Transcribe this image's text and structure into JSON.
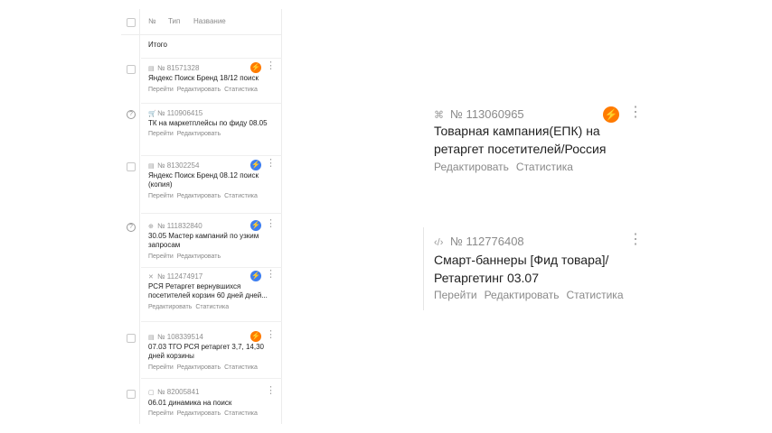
{
  "table": {
    "header": {
      "num": "№",
      "type": "Тип",
      "name": "Название"
    },
    "total_label": "Итого",
    "rows": [
      {
        "num": "№ 81571328",
        "icon": "search-icon",
        "title": "Яндекс Поиск Бренд 18/12 поиск",
        "links": [
          "Перейти",
          "Редактировать",
          "Статистика"
        ],
        "bolt": "orange"
      },
      {
        "num": "№ 110906415",
        "icon": "cart-icon",
        "title": "ТК на маркетплейсы по фиду 08.05",
        "links": [
          "Перейти",
          "Редактировать"
        ],
        "bolt": ""
      },
      {
        "num": "№ 81302254",
        "icon": "search-icon",
        "title": "Яндекс Поиск Бренд 08.12 поиск (копия)",
        "links": [
          "Перейти",
          "Редактировать",
          "Статистика"
        ],
        "bolt": "blue"
      },
      {
        "num": "№ 111832840",
        "icon": "master-icon",
        "title": "30.05 Мастер кампаний по узким запросам",
        "links": [
          "Перейти",
          "Редактировать"
        ],
        "bolt": "blue"
      },
      {
        "num": "№ 112474917",
        "icon": "network-icon",
        "title": "РСЯ Ретаргет вернувшихся посетителей корзин 60 дней дней...",
        "links": [
          "Редактировать",
          "Статистика"
        ],
        "bolt": "blue"
      },
      {
        "num": "№ 108339514",
        "icon": "search-icon",
        "title": "07.03 ТГО РСЯ ретаргет 3,7, 14,30 дней корзины",
        "links": [
          "Перейти",
          "Редактировать",
          "Статистика"
        ],
        "bolt": "orange"
      },
      {
        "num": "№ 82005841",
        "icon": "dynamic-icon",
        "title": "06.01 динамика на поиск",
        "links": [
          "Перейти",
          "Редактировать",
          "Статистика"
        ],
        "bolt": ""
      }
    ]
  },
  "cards": [
    {
      "num": "№ 113060965",
      "icon": "product-campaign-icon",
      "title": "Товарная кампания(ЕПК) на ретаргет посетителей/Россия",
      "links": [
        "Редактировать",
        "Статистика"
      ]
    },
    {
      "num": "№ 112776408",
      "icon": "smart-banner-icon",
      "title": "Смарт-баннеры [Фид товара]/ Ретаргетинг 03.07",
      "links": [
        "Перейти",
        "Редактировать",
        "Статистика"
      ]
    }
  ],
  "colors": {
    "orange": "#ff7a00",
    "blue": "#3d7ef0"
  }
}
